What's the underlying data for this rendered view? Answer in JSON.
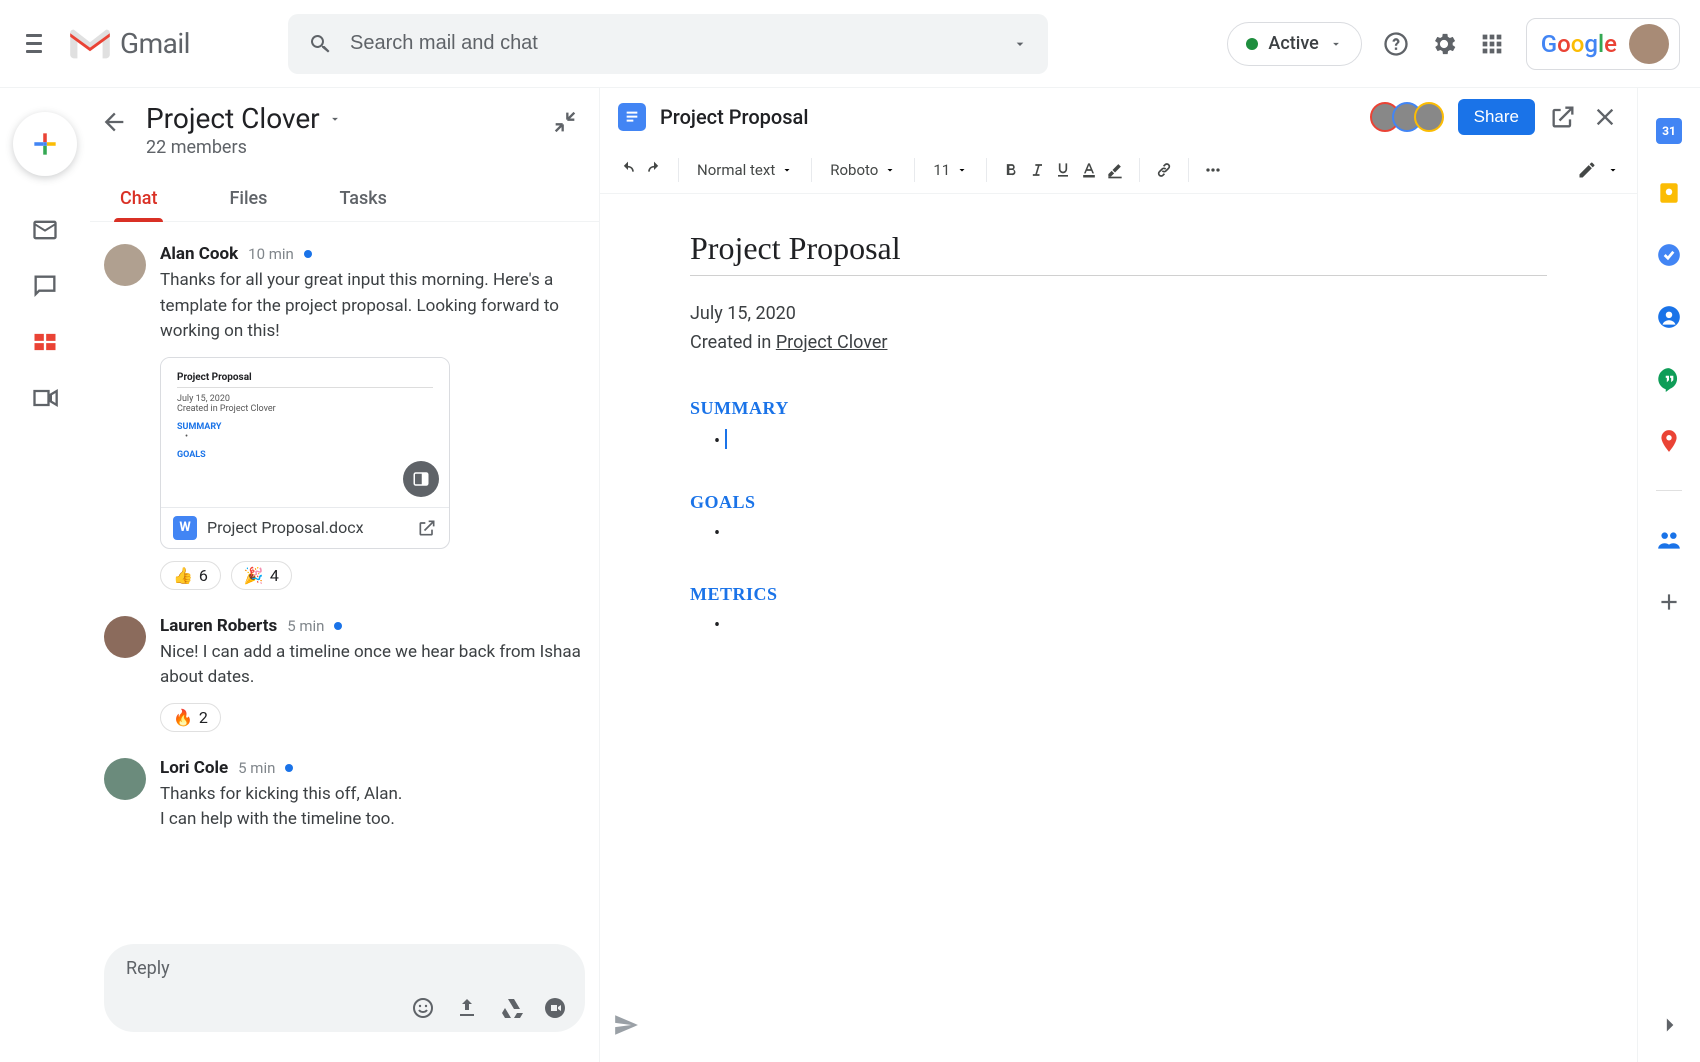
{
  "header": {
    "brand": "Gmail",
    "search_placeholder": "Search mail and chat",
    "status_label": "Active",
    "google_label": "Google"
  },
  "room": {
    "name": "Project Clover",
    "subtitle": "22 members"
  },
  "tabs": [
    {
      "label": "Chat",
      "active": true
    },
    {
      "label": "Files",
      "active": false
    },
    {
      "label": "Tasks",
      "active": false
    }
  ],
  "messages": [
    {
      "name": "Alan Cook",
      "time": "10 min",
      "unread": true,
      "text": "Thanks for all your great input this morning. Here's a template for the project proposal. Looking forward to working on this!",
      "attachment": {
        "filename": "Project Proposal.docx",
        "preview": {
          "title": "Project Proposal",
          "date": "July 15, 2020",
          "created": "Created in Project Clover",
          "sec1": "SUMMARY",
          "sec2": "GOALS"
        }
      },
      "reactions": [
        {
          "emoji": "👍",
          "count": "6"
        },
        {
          "emoji": "🎉",
          "count": "4"
        }
      ]
    },
    {
      "name": "Lauren Roberts",
      "time": "5 min",
      "unread": true,
      "text": "Nice! I can add a timeline once we hear back from Ishaa about dates.",
      "reactions": [
        {
          "emoji": "🔥",
          "count": "2"
        }
      ]
    },
    {
      "name": "Lori Cole",
      "time": "5 min",
      "unread": true,
      "text": "Thanks for kicking this off, Alan.\nI can help with the timeline too."
    }
  ],
  "reply_placeholder": "Reply",
  "doc": {
    "filename": "Project Proposal",
    "share": "Share",
    "toolbar": {
      "style": "Normal text",
      "font": "Roboto",
      "size": "11"
    },
    "body": {
      "title": "Project Proposal",
      "date": "July 15, 2020",
      "created_prefix": "Created in ",
      "created_link": "Project Clover",
      "sections": {
        "summary": "SUMMARY",
        "goals": "GOALS",
        "metrics": "METRICS"
      }
    }
  }
}
